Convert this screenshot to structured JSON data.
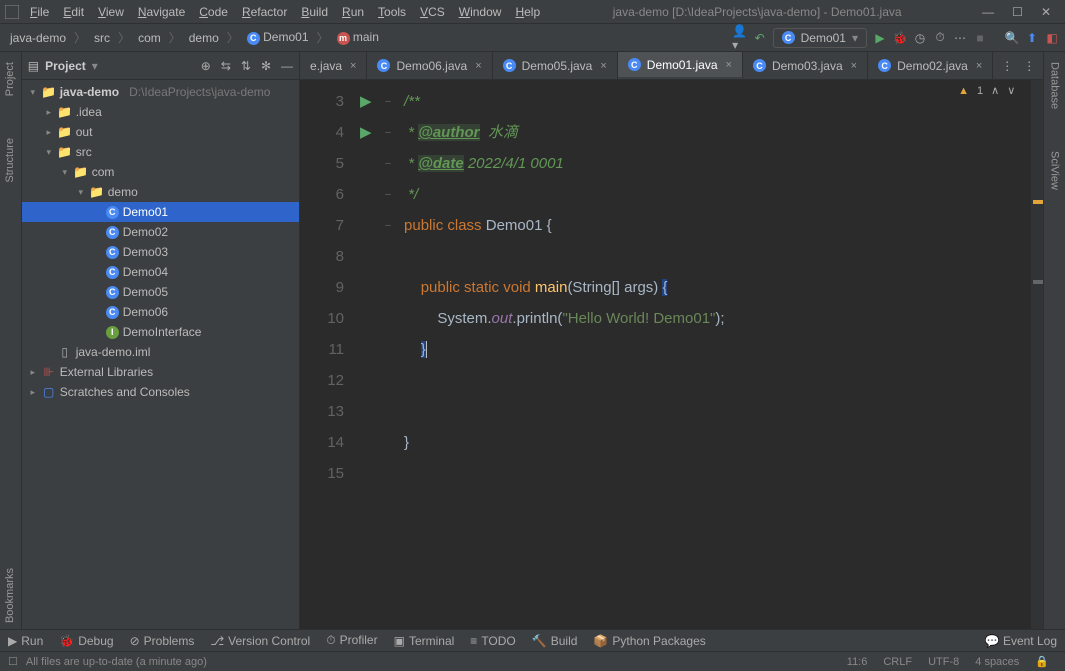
{
  "window": {
    "title": "java-demo [D:\\IdeaProjects\\java-demo] - Demo01.java"
  },
  "menus": [
    "File",
    "Edit",
    "View",
    "Navigate",
    "Code",
    "Refactor",
    "Build",
    "Run",
    "Tools",
    "VCS",
    "Window",
    "Help"
  ],
  "breadcrumb": [
    "java-demo",
    "src",
    "com",
    "demo",
    "Demo01",
    "main"
  ],
  "runconfig": "Demo01",
  "sidebar": {
    "title": "Project",
    "items": [
      {
        "depth": 0,
        "arrow": "v",
        "icon": "folder",
        "label": "java-demo",
        "hint": "D:\\IdeaProjects\\java-demo",
        "bold": true
      },
      {
        "depth": 1,
        "arrow": ">",
        "icon": "folder",
        "label": ".idea"
      },
      {
        "depth": 1,
        "arrow": ">",
        "icon": "folder-orange",
        "label": "out"
      },
      {
        "depth": 1,
        "arrow": "v",
        "icon": "folder-blue",
        "label": "src"
      },
      {
        "depth": 2,
        "arrow": "v",
        "icon": "folder",
        "label": "com"
      },
      {
        "depth": 3,
        "arrow": "v",
        "icon": "folder",
        "label": "demo"
      },
      {
        "depth": 4,
        "arrow": "",
        "icon": "class",
        "label": "Demo01",
        "selected": true
      },
      {
        "depth": 4,
        "arrow": "",
        "icon": "class",
        "label": "Demo02"
      },
      {
        "depth": 4,
        "arrow": "",
        "icon": "class",
        "label": "Demo03"
      },
      {
        "depth": 4,
        "arrow": "",
        "icon": "class",
        "label": "Demo04"
      },
      {
        "depth": 4,
        "arrow": "",
        "icon": "class",
        "label": "Demo05"
      },
      {
        "depth": 4,
        "arrow": "",
        "icon": "class",
        "label": "Demo06"
      },
      {
        "depth": 4,
        "arrow": "",
        "icon": "interface",
        "label": "DemoInterface"
      },
      {
        "depth": 1,
        "arrow": "",
        "icon": "file",
        "label": "java-demo.iml"
      },
      {
        "depth": 0,
        "arrow": ">",
        "icon": "lib",
        "label": "External Libraries"
      },
      {
        "depth": 0,
        "arrow": ">",
        "icon": "scratch",
        "label": "Scratches and Consoles"
      }
    ]
  },
  "tabs": [
    {
      "label": "e.java",
      "icon": "none",
      "partial": true
    },
    {
      "label": "Demo06.java",
      "icon": "class"
    },
    {
      "label": "Demo05.java",
      "icon": "class"
    },
    {
      "label": "Demo01.java",
      "icon": "class",
      "active": true
    },
    {
      "label": "Demo03.java",
      "icon": "class"
    },
    {
      "label": "Demo02.java",
      "icon": "class"
    }
  ],
  "editor": {
    "warnings": "1",
    "lines": [
      {
        "n": 3,
        "fold": "",
        "code_html": "<span class='cmt'>/**</span>"
      },
      {
        "n": 4,
        "fold": "",
        "code_html": "<span class='cmt'> * </span><span class='tag'>@author</span><span class='cmt'>  水滴</span>"
      },
      {
        "n": 5,
        "fold": "",
        "code_html": "<span class='cmt'> * </span><span class='tag'>@date</span><span class='cmt'> 2022/4/1 0001</span>"
      },
      {
        "n": 6,
        "fold": "–",
        "code_html": "<span class='cmt'> */</span>"
      },
      {
        "n": 7,
        "run": true,
        "fold": "–",
        "code_html": "<span class='kw'>public class</span> <span class='cls'>Demo01</span> {"
      },
      {
        "n": 8,
        "fold": "",
        "code_html": ""
      },
      {
        "n": 9,
        "run": true,
        "fold": "–",
        "code_html": "    <span class='kw'>public static void</span> <span class='mth'>main</span>(String[] args) <span class='hl'>{</span>"
      },
      {
        "n": 10,
        "fold": "",
        "code_html": "        System.<span class='fld'>out</span>.println(<span class='str'>\"Hello World! Demo01\"</span>);"
      },
      {
        "n": 11,
        "fold": "–",
        "code_html": "    <span class='hl'>}</span><span class='cursor'></span>"
      },
      {
        "n": 12,
        "fold": "",
        "code_html": ""
      },
      {
        "n": 13,
        "fold": "",
        "code_html": ""
      },
      {
        "n": 14,
        "fold": "–",
        "code_html": "}"
      },
      {
        "n": 15,
        "fold": "",
        "code_html": ""
      }
    ]
  },
  "bottombar": [
    "Run",
    "Debug",
    "Problems",
    "Version Control",
    "Profiler",
    "Terminal",
    "TODO",
    "Build",
    "Python Packages"
  ],
  "eventlog": "Event Log",
  "status": {
    "msg": "All files are up-to-date (a minute ago)",
    "pos": "11:6",
    "eol": "CRLF",
    "enc": "UTF-8",
    "indent": "4 spaces"
  },
  "leftGutter": [
    "Project",
    "Structure",
    "Bookmarks"
  ],
  "rightGutter": [
    "Database",
    "SciView"
  ]
}
